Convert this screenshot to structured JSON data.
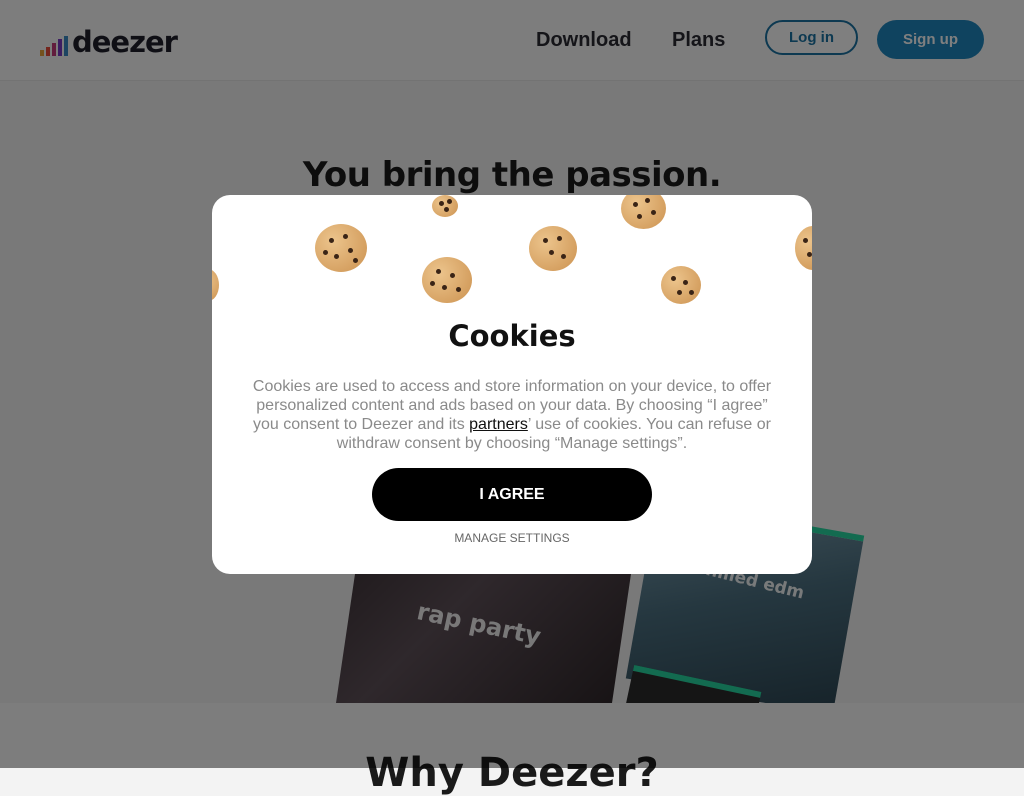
{
  "header": {
    "logo_text": "deezer",
    "nav": {
      "download": "Download",
      "plans": "Plans"
    },
    "login_label": "Log in",
    "signup_label": "Sign up"
  },
  "hero": {
    "title": "You bring the passion.",
    "cards": {
      "rap_party": "rap party",
      "chilled_edm": "chilled edm"
    }
  },
  "section": {
    "why_title": "Why Deezer?"
  },
  "cookie_modal": {
    "title": "Cookies",
    "text_before": "Cookies are used to access and store information on your device, to offer personalized content and ads based on your data. By choosing “I agree” you consent to Deezer and its ",
    "partners_link": "partners",
    "text_after": "’ use of cookies. You can refuse or withdraw consent by choosing “Manage settings”.",
    "agree_label": "I AGREE",
    "manage_label": "MANAGE SETTINGS",
    "icon": "cookie-icon"
  },
  "colors": {
    "brand_blue": "#1f86be",
    "login_border": "#1a73a3",
    "agree_bg": "#000000",
    "accent_green": "#27d6a0"
  }
}
